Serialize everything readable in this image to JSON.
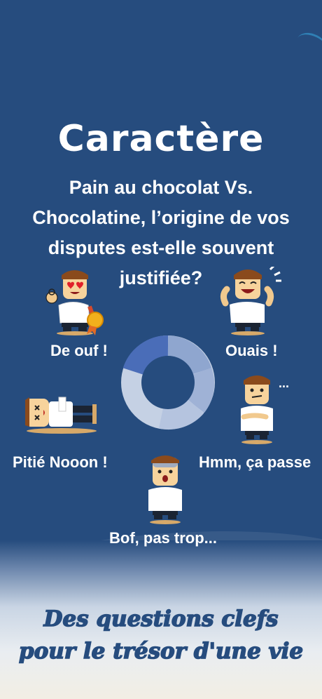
{
  "header": {
    "title": "Caractère",
    "question": "Pain au chocolat Vs. Chocolatine, l’origine de vos disputes est-elle souvent justifiée?"
  },
  "answers": [
    {
      "label": "De ouf !",
      "mood": "love-eyes-with-medal"
    },
    {
      "label": "Ouais !",
      "mood": "laughing-cheering"
    },
    {
      "label": "Pitié Nooon !",
      "mood": "knocked-out-lying"
    },
    {
      "label": "Hmm, ça passe",
      "mood": "thinking"
    },
    {
      "label": "Bof, pas trop...",
      "mood": "shocked-disappointed"
    }
  ],
  "thinking_dots": "...",
  "slogan": {
    "line1": "Des questions clefs",
    "line2": "pour le trésor d'une vie"
  },
  "colors": {
    "background": "#264c7e",
    "text": "#ffffff",
    "donut_light": "#c5d1e4",
    "donut_mid": "#8fa6cf",
    "donut_dark": "#4a6db8"
  }
}
